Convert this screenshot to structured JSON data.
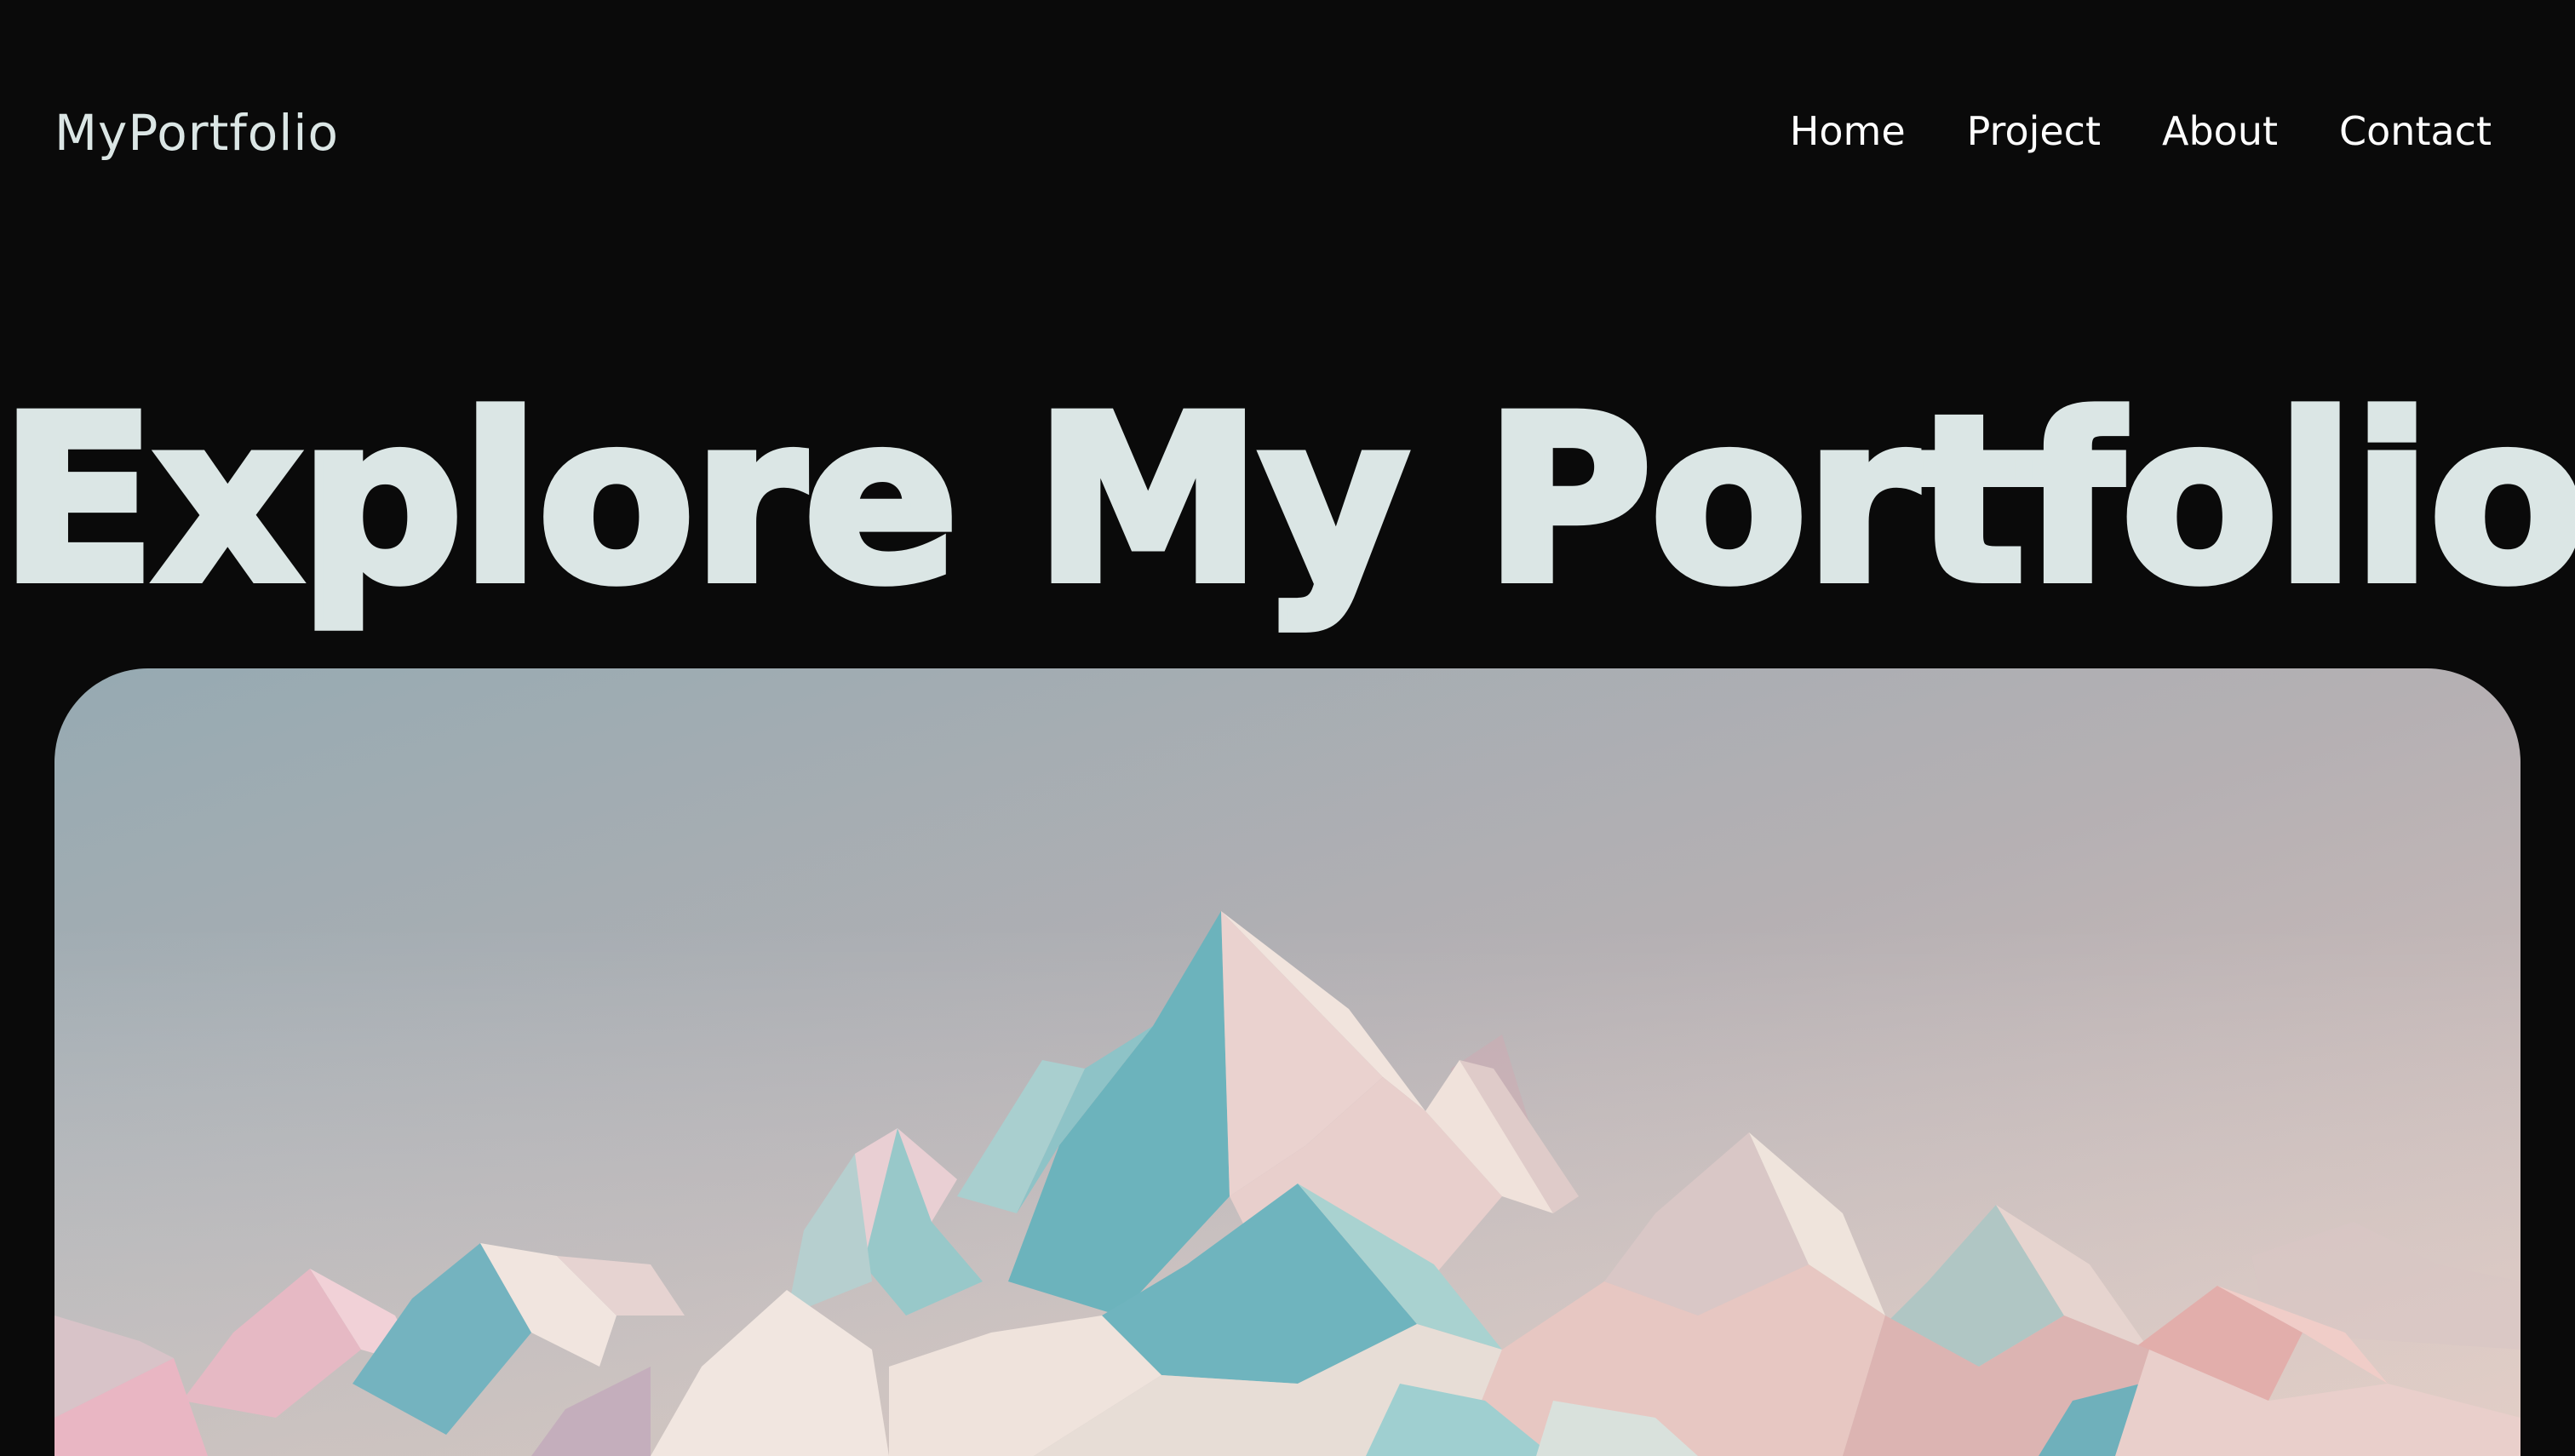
{
  "header": {
    "logo_text": "MyPortfolio",
    "nav": [
      {
        "label": "Home"
      },
      {
        "label": "Project"
      },
      {
        "label": "About"
      },
      {
        "label": "Contact"
      }
    ]
  },
  "hero": {
    "title": "Explore My Portfolio",
    "image_icon": "mountain-landscape-illustration"
  },
  "colors": {
    "background": "#0a0a0a",
    "title_text": "#dbe6e5",
    "nav_text": "#ffffff",
    "sky_left": "#97a9b0",
    "sky_right": "#d6bcbb",
    "teal": "#5fafb9",
    "pink": "#e4b2bf",
    "cream": "#f2e8de"
  }
}
